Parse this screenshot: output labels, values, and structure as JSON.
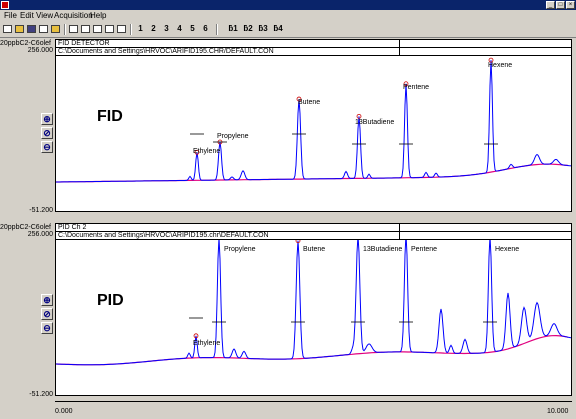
{
  "menu": [
    "File",
    "Edit",
    "View",
    "Acquisition",
    "Help"
  ],
  "toolbar": {
    "channel_buttons": [
      "1",
      "2",
      "3",
      "4",
      "5",
      "6"
    ],
    "set_buttons": [
      "ƃ1",
      "ƃ2",
      "ƃ3",
      "ƃ4"
    ]
  },
  "top": {
    "channel": "20ppbC2-C6olef",
    "detector": "FID DETECTOR",
    "path": "C:\\Documents and Settings\\HRVOC\\ARIFID195.CHR/DEFAULT.CON",
    "ymax": "256.000",
    "ymin": "-51.200",
    "label": "FID",
    "peaks": [
      "Ethylene",
      "Propylene",
      "Butene",
      "13Butadiene",
      "Pentene",
      "Hexene"
    ]
  },
  "bottom": {
    "channel": "20ppbC2-C6olef",
    "detector": "PID Ch 2",
    "path": "C:\\Documents and Settings\\HRVOC\\ARIPID195.chr\\DEFAULT.CON",
    "ymax": "256.000",
    "ymin": "-51.200",
    "label": "PID",
    "peaks": [
      "Ethylene",
      "Propylene",
      "Butene",
      "13Butadiene",
      "Pentene",
      "Hexene"
    ]
  },
  "xaxis": {
    "min": "0.000",
    "max": "10.000"
  },
  "colors": {
    "trace": "#0000ff",
    "baseline": "#e0007f",
    "marker": "#cc0000"
  }
}
